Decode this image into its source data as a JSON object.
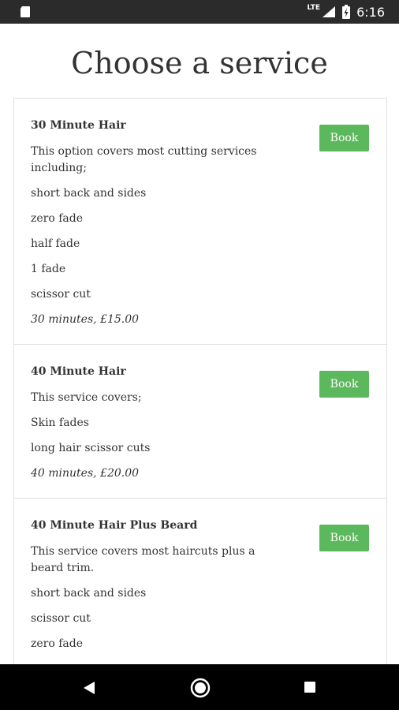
{
  "status_bar": {
    "network": "LTE",
    "time": "6:16"
  },
  "page": {
    "title": "Choose a service"
  },
  "services": [
    {
      "name": "30 Minute Hair",
      "lines": [
        "This option covers most cutting services including;",
        "short back and sides",
        "zero fade",
        "half fade",
        "1 fade",
        "scissor cut"
      ],
      "meta": "30 minutes, £15.00",
      "button_label": "Book"
    },
    {
      "name": "40 Minute Hair",
      "lines": [
        "This service covers;",
        "Skin fades",
        "long hair scissor cuts"
      ],
      "meta": "40 minutes, £20.00",
      "button_label": "Book"
    },
    {
      "name": "40 Minute Hair Plus Beard",
      "lines": [
        "This service covers most haircuts plus a beard trim.",
        "short back and sides",
        "scissor cut",
        "zero fade"
      ],
      "meta": "",
      "button_label": "Book"
    }
  ],
  "colors": {
    "book_button": "#5cb85c",
    "status_bar": "#2b2b2b",
    "nav_bar": "#000000"
  },
  "icons": {
    "status_left": "sd-card-icon",
    "signal": "cell-signal-icon",
    "battery": "battery-charging-icon",
    "nav_back": "back-triangle-icon",
    "nav_home": "home-circle-icon",
    "nav_recents": "recents-square-icon"
  }
}
